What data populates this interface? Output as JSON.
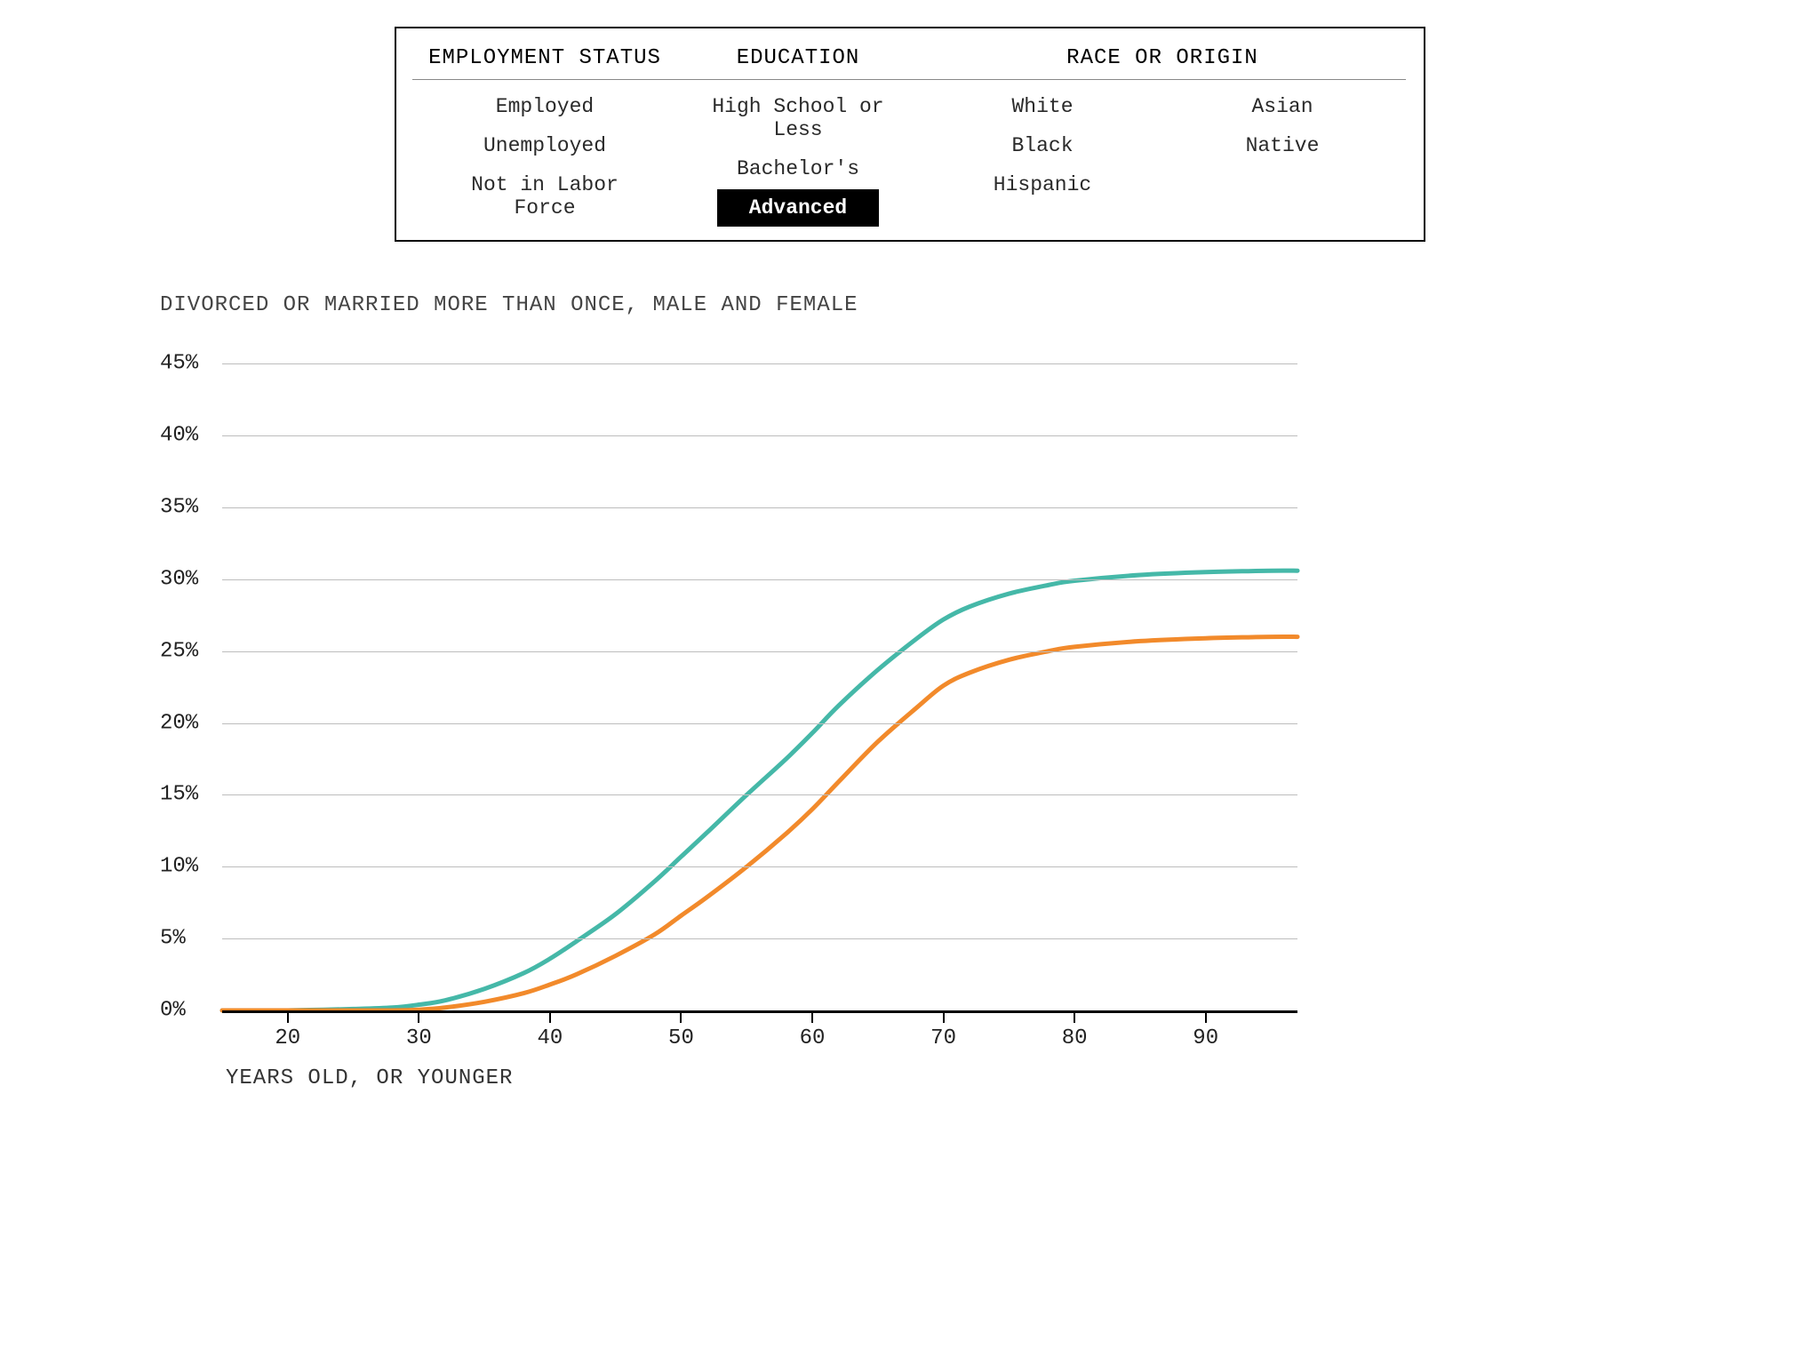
{
  "filters": {
    "employment": {
      "header": "EMPLOYMENT STATUS",
      "options": [
        "Employed",
        "Unemployed",
        "Not in Labor Force"
      ],
      "selected": null
    },
    "education": {
      "header": "EDUCATION",
      "options": [
        "High School or Less",
        "Bachelor's",
        "Advanced"
      ],
      "selected": "Advanced"
    },
    "race": {
      "header": "RACE OR ORIGIN",
      "options": [
        "White",
        "Asian",
        "Black",
        "Native",
        "Hispanic"
      ],
      "selected": null
    }
  },
  "chart_title": "DIVORCED OR MARRIED MORE THAN ONCE, MALE AND FEMALE",
  "x_axis_title": "YEARS OLD, OR YOUNGER",
  "y_ticks_pct": [
    0,
    5,
    10,
    15,
    20,
    25,
    30,
    35,
    40,
    45
  ],
  "x_ticks": [
    20,
    30,
    40,
    50,
    60,
    70,
    80,
    90
  ],
  "chart_data": {
    "type": "line",
    "title": "DIVORCED OR MARRIED MORE THAN ONCE, MALE AND FEMALE",
    "xlabel": "YEARS OLD, OR YOUNGER",
    "ylabel": "",
    "xlim": [
      15,
      97
    ],
    "ylim": [
      0,
      47
    ],
    "y_unit": "%",
    "series": [
      {
        "name": "series_teal",
        "color": "#45b8a8",
        "x": [
          15,
          20,
          25,
          28,
          30,
          32,
          35,
          38,
          40,
          42,
          45,
          48,
          50,
          52,
          55,
          58,
          60,
          62,
          65,
          68,
          70,
          72,
          75,
          78,
          80,
          85,
          90,
          95,
          97
        ],
        "values": [
          0,
          0,
          0.1,
          0.2,
          0.4,
          0.7,
          1.5,
          2.6,
          3.6,
          4.8,
          6.7,
          9.0,
          10.7,
          12.4,
          15.0,
          17.5,
          19.3,
          21.2,
          23.7,
          25.9,
          27.2,
          28.1,
          29.0,
          29.6,
          29.9,
          30.3,
          30.5,
          30.6,
          30.6
        ]
      },
      {
        "name": "series_orange",
        "color": "#f28a2b",
        "x": [
          15,
          20,
          25,
          28,
          30,
          32,
          35,
          38,
          40,
          42,
          45,
          48,
          50,
          52,
          55,
          58,
          60,
          62,
          65,
          68,
          70,
          72,
          75,
          78,
          80,
          85,
          90,
          95,
          97
        ],
        "values": [
          0,
          0,
          0,
          0,
          0.05,
          0.2,
          0.6,
          1.2,
          1.8,
          2.5,
          3.8,
          5.3,
          6.6,
          7.9,
          10.0,
          12.3,
          14.0,
          15.9,
          18.7,
          21.1,
          22.6,
          23.5,
          24.4,
          25.0,
          25.3,
          25.7,
          25.9,
          26.0,
          26.0
        ]
      }
    ]
  }
}
